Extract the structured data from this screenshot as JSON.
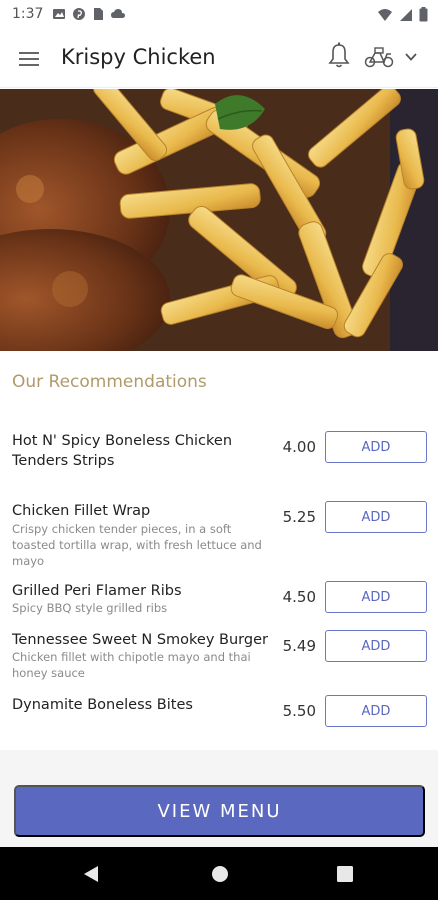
{
  "status_bar": {
    "time": "1:37",
    "icons": [
      "image-icon",
      "pinterest-icon",
      "sim-icon",
      "cloud-icon"
    ],
    "right_icons": [
      "wifi-icon",
      "signal-icon",
      "battery-icon"
    ]
  },
  "app_bar": {
    "title": "Krispy Chicken",
    "icons": [
      "menu-icon",
      "bell-icon",
      "delivery-bike-icon",
      "chevron-down-icon"
    ]
  },
  "hero": {
    "description_icon": "food-photo"
  },
  "recommendations": {
    "title": "Our Recommendations",
    "items": [
      {
        "name": "Hot N' Spicy Boneless Chicken Tenders Strips",
        "description": "",
        "price": "4.00",
        "add_label": "ADD"
      },
      {
        "name": "Chicken Fillet Wrap",
        "description": "Crispy chicken tender pieces, in a soft toasted tortilla wrap, with fresh lettuce and mayo",
        "price": "5.25",
        "add_label": "ADD"
      },
      {
        "name": "Grilled Peri Flamer Ribs",
        "description": "Spicy BBQ style grilled ribs",
        "price": "4.50",
        "add_label": "ADD"
      },
      {
        "name": "Tennessee Sweet N Smokey Burger",
        "description": "Chicken fillet with chipotle mayo and thai honey sauce",
        "price": "5.49",
        "add_label": "ADD"
      },
      {
        "name": "Dynamite Boneless Bites",
        "description": "",
        "price": "5.50",
        "add_label": "ADD"
      }
    ]
  },
  "view_menu_label": "VIEW MENU",
  "nav_bar": {
    "icons": [
      "back-icon",
      "home-icon",
      "recents-icon"
    ]
  },
  "colors": {
    "accent": "#5a68bf",
    "section_title": "#b09a6a"
  }
}
